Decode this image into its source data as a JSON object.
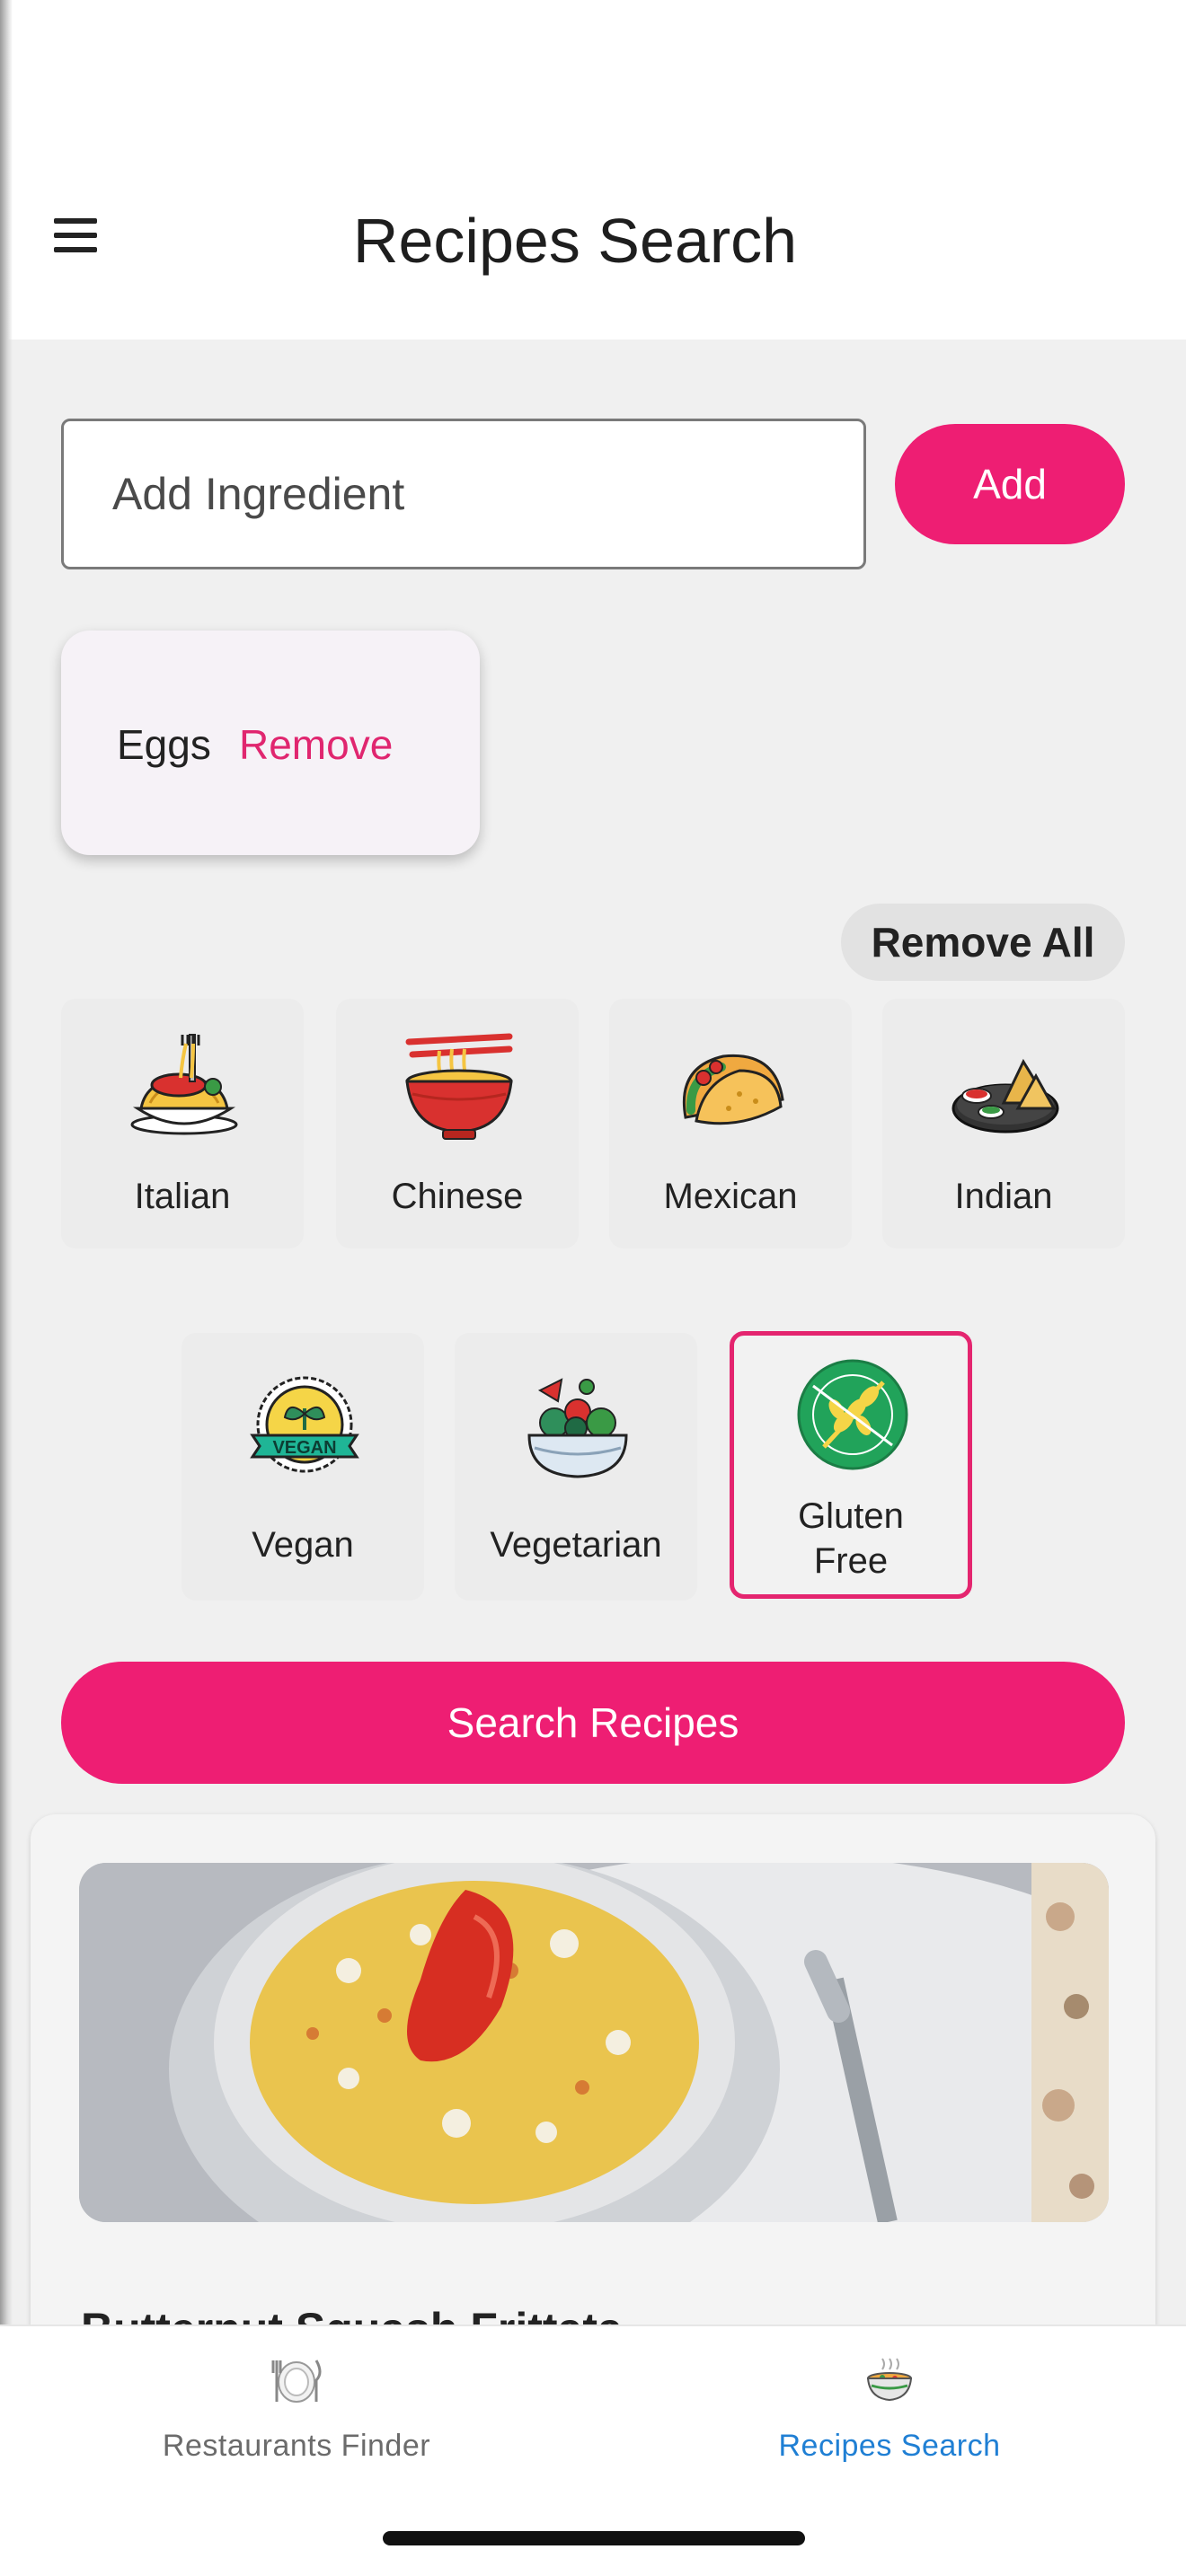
{
  "header": {
    "title": "Recipes Search"
  },
  "ingredient_form": {
    "placeholder": "Add Ingredient",
    "add_label": "Add"
  },
  "ingredients": [
    {
      "name": "Eggs",
      "remove_label": "Remove"
    }
  ],
  "remove_all_label": "Remove All",
  "cuisines": [
    {
      "label": "Italian",
      "icon": "pasta-icon",
      "selected": false
    },
    {
      "label": "Chinese",
      "icon": "noodle-bowl-icon",
      "selected": false
    },
    {
      "label": "Mexican",
      "icon": "taco-icon",
      "selected": false
    },
    {
      "label": "Indian",
      "icon": "samosa-icon",
      "selected": false
    }
  ],
  "diets": [
    {
      "label": "Vegan",
      "icon": "vegan-badge-icon",
      "selected": false
    },
    {
      "label": "Vegetarian",
      "icon": "salad-bowl-icon",
      "selected": false
    },
    {
      "label_line1": "Gluten",
      "label_line2": "Free",
      "icon": "gluten-free-icon",
      "selected": true
    }
  ],
  "search_button_label": "Search Recipes",
  "recipe": {
    "title": "Butternut Squash Frittata"
  },
  "bottom_nav": [
    {
      "label": "Restaurants Finder",
      "icon": "plate-cutlery-icon",
      "active": false
    },
    {
      "label": "Recipes Search",
      "icon": "soup-bowl-icon",
      "active": true
    }
  ],
  "colors": {
    "accent": "#ee1e73",
    "active_nav": "#1f7fd4"
  }
}
